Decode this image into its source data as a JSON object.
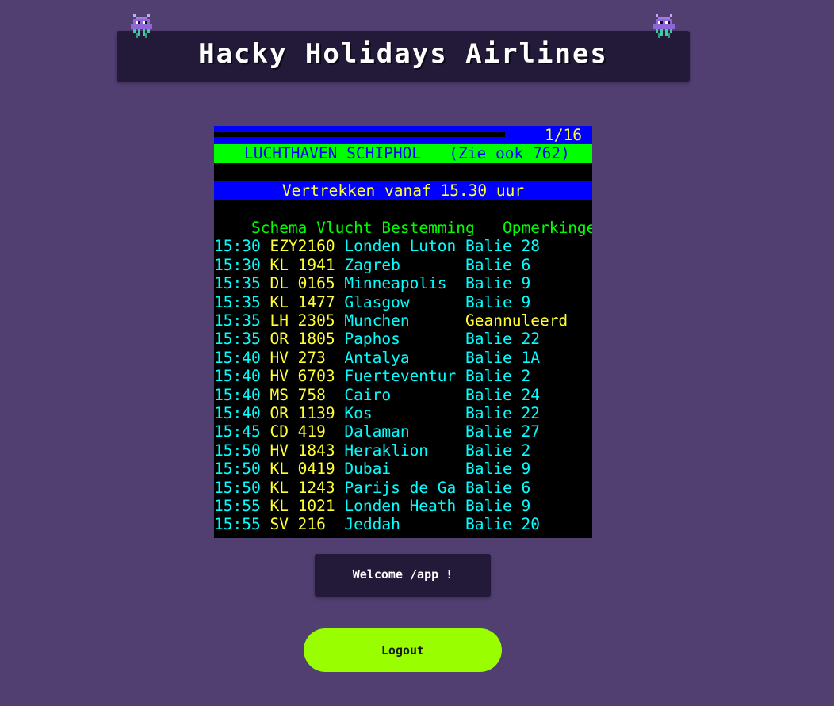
{
  "banner": {
    "title": "Hacky Holidays Airlines",
    "left_icon": "alien-icon",
    "right_icon": "alien-icon"
  },
  "teletext": {
    "page_indicator": "1/16",
    "progress": 0.77,
    "station": "LUCHTHAVEN SCHIPHOL   (Zie ook 762)",
    "section_title": "Vertrekken vanaf 15.30 uur",
    "columns": {
      "schedule": "Schema",
      "flight": "Vlucht",
      "destination": "Bestemming",
      "remarks": "Opmerkingen"
    },
    "departures": [
      {
        "time": "15:30",
        "flight": "EZY2160",
        "destination": "Londen Luton",
        "remark": "Balie 28"
      },
      {
        "time": "15:30",
        "flight": "KL 1941",
        "destination": "Zagreb",
        "remark": "Balie 6"
      },
      {
        "time": "15:35",
        "flight": "DL 0165",
        "destination": "Minneapolis",
        "remark": "Balie 9"
      },
      {
        "time": "15:35",
        "flight": "KL 1477",
        "destination": "Glasgow",
        "remark": "Balie 9"
      },
      {
        "time": "15:35",
        "flight": "LH 2305",
        "destination": "Munchen",
        "remark": "Geannuleerd"
      },
      {
        "time": "15:35",
        "flight": "OR 1805",
        "destination": "Paphos",
        "remark": "Balie 22"
      },
      {
        "time": "15:40",
        "flight": "HV 273",
        "destination": "Antalya",
        "remark": "Balie 1A"
      },
      {
        "time": "15:40",
        "flight": "HV 6703",
        "destination": "Fuerteventur",
        "remark": "Balie 2"
      },
      {
        "time": "15:40",
        "flight": "MS 758",
        "destination": "Cairo",
        "remark": "Balie 24"
      },
      {
        "time": "15:40",
        "flight": "OR 1139",
        "destination": "Kos",
        "remark": "Balie 22"
      },
      {
        "time": "15:45",
        "flight": "CD 419",
        "destination": "Dalaman",
        "remark": "Balie 27"
      },
      {
        "time": "15:50",
        "flight": "HV 1843",
        "destination": "Heraklion",
        "remark": "Balie 2"
      },
      {
        "time": "15:50",
        "flight": "KL 0419",
        "destination": "Dubai",
        "remark": "Balie 9"
      },
      {
        "time": "15:50",
        "flight": "KL 1243",
        "destination": "Parijs de Ga",
        "remark": "Balie 6"
      },
      {
        "time": "15:55",
        "flight": "KL 1021",
        "destination": "Londen Heath",
        "remark": "Balie 9"
      },
      {
        "time": "15:55",
        "flight": "SV 216",
        "destination": "Jeddah",
        "remark": "Balie 20"
      }
    ]
  },
  "welcome": {
    "text": "Welcome /app !"
  },
  "logout": {
    "label": "Logout"
  },
  "colors": {
    "background": "#523f72",
    "panel": "#221a38",
    "teletext_blue": "#0000ff",
    "teletext_green": "#00ff00",
    "teletext_cyan": "#00ffff",
    "teletext_yellow": "#ffff33",
    "logout_button": "#99ff00"
  }
}
